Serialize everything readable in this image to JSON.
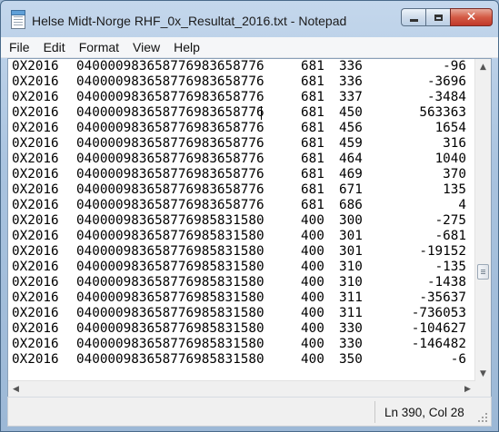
{
  "window": {
    "title": "Helse Midt-Norge RHF_0x_Resultat_2016.txt - Notepad"
  },
  "icons": {
    "app": "notepad-icon",
    "minimize": "minimize-icon",
    "maximize": "maximize-icon",
    "close": "close-icon"
  },
  "menu": [
    "File",
    "Edit",
    "Format",
    "View",
    "Help"
  ],
  "rows": [
    {
      "year": "0X2016",
      "id": "040000983658776983658776",
      "a": "681",
      "b": "336",
      "value": "-96"
    },
    {
      "year": "0X2016",
      "id": "040000983658776983658776",
      "a": "681",
      "b": "336",
      "value": "-3696"
    },
    {
      "year": "0X2016",
      "id": "040000983658776983658776",
      "a": "681",
      "b": "337",
      "value": "-3484"
    },
    {
      "year": "0X2016",
      "id": "040000983658776983658776",
      "a": "681",
      "b": "450",
      "value": "563363"
    },
    {
      "year": "0X2016",
      "id": "040000983658776983658776",
      "a": "681",
      "b": "456",
      "value": "1654"
    },
    {
      "year": "0X2016",
      "id": "040000983658776983658776",
      "a": "681",
      "b": "459",
      "value": "316"
    },
    {
      "year": "0X2016",
      "id": "040000983658776983658776",
      "a": "681",
      "b": "464",
      "value": "1040"
    },
    {
      "year": "0X2016",
      "id": "040000983658776983658776",
      "a": "681",
      "b": "469",
      "value": "370"
    },
    {
      "year": "0X2016",
      "id": "040000983658776983658776",
      "a": "681",
      "b": "671",
      "value": "135"
    },
    {
      "year": "0X2016",
      "id": "040000983658776983658776",
      "a": "681",
      "b": "686",
      "value": "4"
    },
    {
      "year": "0X2016",
      "id": "040000983658776985831580",
      "a": "400",
      "b": "300",
      "value": "-275"
    },
    {
      "year": "0X2016",
      "id": "040000983658776985831580",
      "a": "400",
      "b": "301",
      "value": "-681"
    },
    {
      "year": "0X2016",
      "id": "040000983658776985831580",
      "a": "400",
      "b": "301",
      "value": "-19152"
    },
    {
      "year": "0X2016",
      "id": "040000983658776985831580",
      "a": "400",
      "b": "310",
      "value": "-135"
    },
    {
      "year": "0X2016",
      "id": "040000983658776985831580",
      "a": "400",
      "b": "310",
      "value": "-1438"
    },
    {
      "year": "0X2016",
      "id": "040000983658776985831580",
      "a": "400",
      "b": "311",
      "value": "-35637"
    },
    {
      "year": "0X2016",
      "id": "040000983658776985831580",
      "a": "400",
      "b": "311",
      "value": "-736053"
    },
    {
      "year": "0X2016",
      "id": "040000983658776985831580",
      "a": "400",
      "b": "330",
      "value": "-104627"
    },
    {
      "year": "0X2016",
      "id": "040000983658776985831580",
      "a": "400",
      "b": "330",
      "value": "-146482"
    },
    {
      "year": "0X2016",
      "id": "040000983658776985831580",
      "a": "400",
      "b": "350",
      "value": "-6"
    }
  ],
  "status": {
    "position": "Ln 390, Col 28"
  }
}
